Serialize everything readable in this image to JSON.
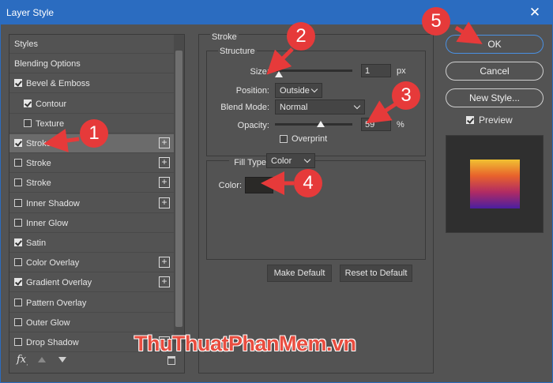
{
  "window": {
    "title": "Layer Style",
    "close_glyph": "✕"
  },
  "styles_panel": {
    "items": [
      {
        "label": "Styles",
        "checkbox": null,
        "plus": false,
        "indent": 0
      },
      {
        "label": "Blending Options",
        "checkbox": null,
        "plus": false,
        "indent": 0
      },
      {
        "label": "Bevel & Emboss",
        "checkbox": true,
        "plus": false,
        "indent": 0
      },
      {
        "label": "Contour",
        "checkbox": true,
        "plus": false,
        "indent": 1
      },
      {
        "label": "Texture",
        "checkbox": false,
        "plus": false,
        "indent": 1
      },
      {
        "label": "Stroke",
        "checkbox": true,
        "plus": true,
        "indent": 0,
        "selected": true
      },
      {
        "label": "Stroke",
        "checkbox": false,
        "plus": true,
        "indent": 0
      },
      {
        "label": "Stroke",
        "checkbox": false,
        "plus": true,
        "indent": 0
      },
      {
        "label": "Inner Shadow",
        "checkbox": false,
        "plus": true,
        "indent": 0
      },
      {
        "label": "Inner Glow",
        "checkbox": false,
        "plus": false,
        "indent": 0
      },
      {
        "label": "Satin",
        "checkbox": true,
        "plus": false,
        "indent": 0
      },
      {
        "label": "Color Overlay",
        "checkbox": false,
        "plus": true,
        "indent": 0
      },
      {
        "label": "Gradient Overlay",
        "checkbox": true,
        "plus": true,
        "indent": 0
      },
      {
        "label": "Pattern Overlay",
        "checkbox": false,
        "plus": false,
        "indent": 0
      },
      {
        "label": "Outer Glow",
        "checkbox": false,
        "plus": false,
        "indent": 0
      },
      {
        "label": "Drop Shadow",
        "checkbox": false,
        "plus": true,
        "indent": 0
      }
    ],
    "footer": {
      "fx_label": "fx",
      "fx_sub": "."
    }
  },
  "stroke": {
    "section_title": "Stroke",
    "structure_title": "Structure",
    "size_label": "Size:",
    "size_value": "1",
    "size_unit": "px",
    "position_label": "Position:",
    "position_value": "Outside",
    "blend_label": "Blend Mode:",
    "blend_value": "Normal",
    "opacity_label": "Opacity:",
    "opacity_value": "59",
    "opacity_unit": "%",
    "overprint_label": "Overprint",
    "fill_type_label": "Fill Type:",
    "fill_type_value": "Color",
    "color_label": "Color:",
    "stroke_color": "#2a2927",
    "make_default": "Make Default",
    "reset_default": "Reset to Default"
  },
  "right": {
    "ok": "OK",
    "cancel": "Cancel",
    "new_style": "New Style...",
    "preview_label": "Preview",
    "preview_checked": true
  },
  "annotations": [
    "1",
    "2",
    "3",
    "4",
    "5"
  ],
  "watermark": "ThuThuatPhanMem.vn",
  "colors": {
    "accent": "#2b6cc0",
    "annotation": "#e63a3a",
    "ok_border": "#4a90e2"
  }
}
